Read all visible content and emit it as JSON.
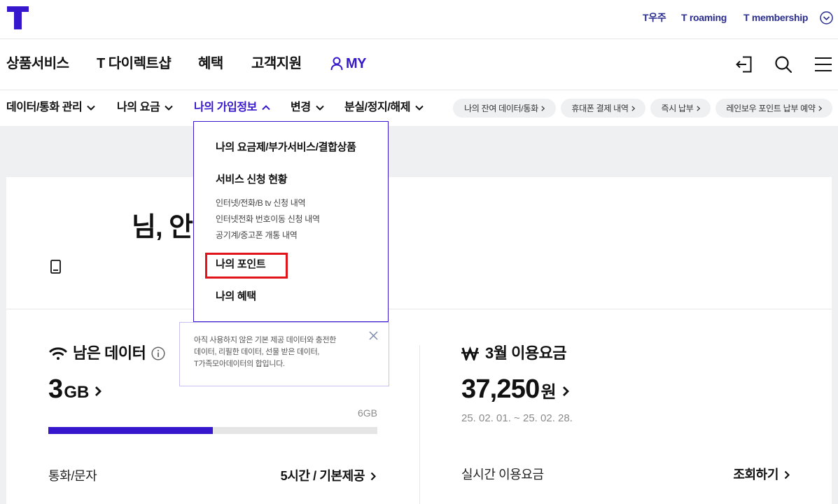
{
  "colors": {
    "brand": "#3617CE",
    "utility": "#2A2D8F",
    "highlight": "#E2141B",
    "page_bg": "#EEF0F2",
    "muted": "#8A8A8A"
  },
  "header": {
    "logo": "T",
    "logo_icon": "t-logo-icon",
    "utility_links": [
      "T우주",
      "T roaming",
      "T membership"
    ],
    "utility_toggle_icon": "chevron-down-circle-icon"
  },
  "main_nav": {
    "items": [
      "상품서비스",
      "T 다이렉트샵",
      "혜택",
      "고객지원"
    ],
    "my": {
      "label": "MY",
      "icon": "person-icon"
    },
    "actions": [
      {
        "icon": "logout-icon"
      },
      {
        "icon": "search-icon"
      },
      {
        "icon": "menu-icon"
      }
    ]
  },
  "sub_nav": {
    "items": [
      {
        "label": "데이터/통화 관리",
        "expanded": false
      },
      {
        "label": "나의 요금",
        "expanded": false
      },
      {
        "label": "나의 가입정보",
        "expanded": true
      },
      {
        "label": "변경",
        "expanded": false
      },
      {
        "label": "분실/정지/해제",
        "expanded": false
      }
    ],
    "quick_links": [
      "나의 잔여 데이터/통화",
      "휴대폰 결제 내역",
      "즉시 납부",
      "레인보우 포인트 납부 예약"
    ]
  },
  "dropdown": {
    "groups": [
      {
        "title": "나의 요금제/부가서비스/결합상품",
        "highlighted": false,
        "items": []
      },
      {
        "title": "서비스 신청 현황",
        "highlighted": false,
        "items": [
          "인터넷/전화/B tv 신청 내역",
          "인터넷전화 번호이동 신청 내역",
          "공기계/중고폰 개통 내역"
        ]
      },
      {
        "title": "나의 포인트",
        "highlighted": true,
        "items": []
      },
      {
        "title": "나의 혜택",
        "highlighted": false,
        "items": []
      }
    ]
  },
  "profile": {
    "greeting": "님, 안",
    "line_icon": "phone-icon"
  },
  "data_usage": {
    "icon": "wifi-icon",
    "title": "남은 데이터",
    "info_icon": "info-icon",
    "remaining_value": "3",
    "remaining_unit": "GB",
    "total": "6GB",
    "remaining_ratio": 0.5,
    "call_sms_label": "통화/문자",
    "call_sms_value": "5시간 / 기본제공"
  },
  "tooltip": {
    "lines": [
      "아직 사용하지 않은 기본 제공 데이터와 충전한",
      "데이터, 리필한 데이터, 선물 받은 데이터,",
      "T가족모아데이터의 합입니다."
    ],
    "close_icon": "close-icon"
  },
  "billing": {
    "icon": "won-icon",
    "title": "3월 이용요금",
    "amount": "37,250",
    "currency": "원",
    "period": "25. 02. 01. ~ 25. 02. 28.",
    "realtime_label": "실시간 이용요금",
    "realtime_action": "조회하기"
  }
}
